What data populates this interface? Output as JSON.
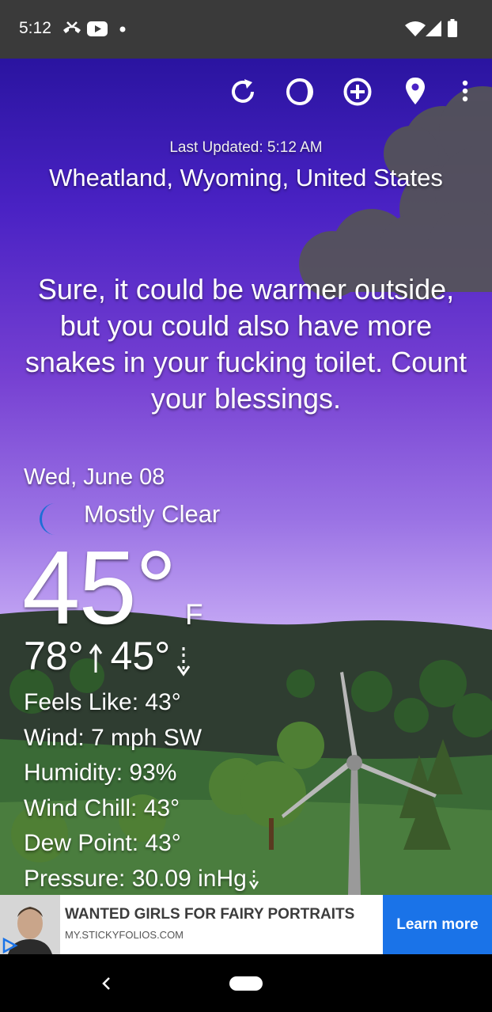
{
  "status_bar": {
    "time": "5:12",
    "icons": [
      "missed-call-icon",
      "youtube-icon",
      "notification-dot-icon",
      "wifi-icon",
      "signal-icon",
      "battery-icon"
    ]
  },
  "toolbar": {
    "icons": [
      "refresh-icon",
      "theme-icon",
      "add-location-icon",
      "location-pin-icon",
      "more-options-icon"
    ]
  },
  "header": {
    "last_updated": "Last Updated: 5:12 AM",
    "location": "Wheatland, Wyoming, United States"
  },
  "quote": "Sure, it could be warmer outside, but you could also have more snakes in your fucking toilet. Count your blessings.",
  "weather": {
    "date": "Wed, June 08",
    "condition": "Mostly Clear",
    "condition_icon": "crescent-moon-icon",
    "temperature": "45°",
    "unit": "F",
    "high": "78°",
    "low": "45°",
    "details": [
      "Feels Like:  43°",
      "Wind:  7 mph SW",
      "Humidity:  93%",
      "Wind Chill:  43°",
      "Dew Point:  43°",
      "Pressure:  30.09 inHg"
    ],
    "pressure_trend": "falling"
  },
  "ad": {
    "headline": "WANTED GIRLS FOR FAIRY PORTRAITS",
    "url": "MY.STICKYFOLIOS.COM",
    "cta": "Learn more"
  },
  "colors": {
    "accent": "#1a73e8",
    "moon": "#1e6ed6",
    "sky_top": "#2a14a0",
    "sky_bottom": "#d8c4fb"
  }
}
